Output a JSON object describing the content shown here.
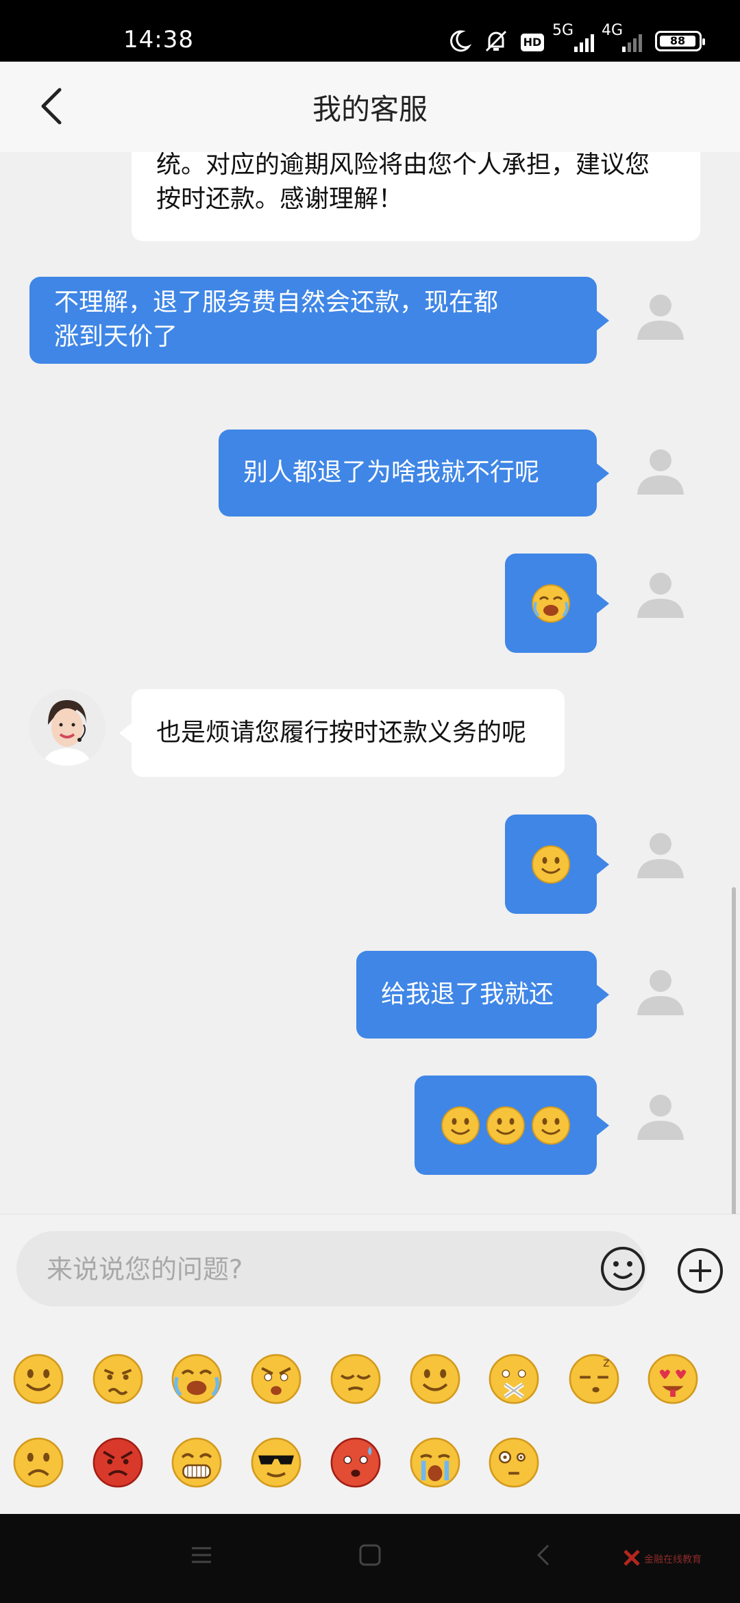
{
  "status_bar": {
    "time": "14:38",
    "signal_5g": "5G",
    "signal_4g": "4G",
    "hd_label": "HD",
    "battery": "88"
  },
  "header": {
    "title": "我的客服"
  },
  "messages": [
    {
      "from": "cs",
      "lines": [
        "统。对应的逾期风险将由您个人承担，建议您",
        "按时还款。感谢理解！"
      ]
    },
    {
      "from": "me",
      "lines": [
        "不理解，退了服务费自然会还款，现在都",
        "涨到天价了"
      ]
    },
    {
      "from": "me",
      "lines": [
        "别人都退了为啥我就不行呢"
      ]
    },
    {
      "from": "me",
      "emoji": [
        "crying-laughing-emoji"
      ]
    },
    {
      "from": "cs",
      "lines": [
        "也是烦请您履行按时还款义务的呢"
      ]
    },
    {
      "from": "me",
      "emoji": [
        "smile-emoji"
      ]
    },
    {
      "from": "me",
      "lines": [
        "给我退了我就还"
      ]
    },
    {
      "from": "me",
      "emoji": [
        "smile-emoji",
        "smile-emoji",
        "smile-emoji"
      ]
    }
  ],
  "input": {
    "placeholder": "来说说您的问题?"
  },
  "emoji_panel": {
    "row1": [
      "smile",
      "worried",
      "crying-laughing",
      "angry",
      "sleepy-content",
      "smile",
      "muted",
      "sleeping",
      "heart-eyes"
    ],
    "row2": [
      "sad",
      "furious",
      "grin",
      "sunglasses",
      "blushing-sweat",
      "crying",
      "confused"
    ]
  },
  "watermark": "金融在线教育"
}
